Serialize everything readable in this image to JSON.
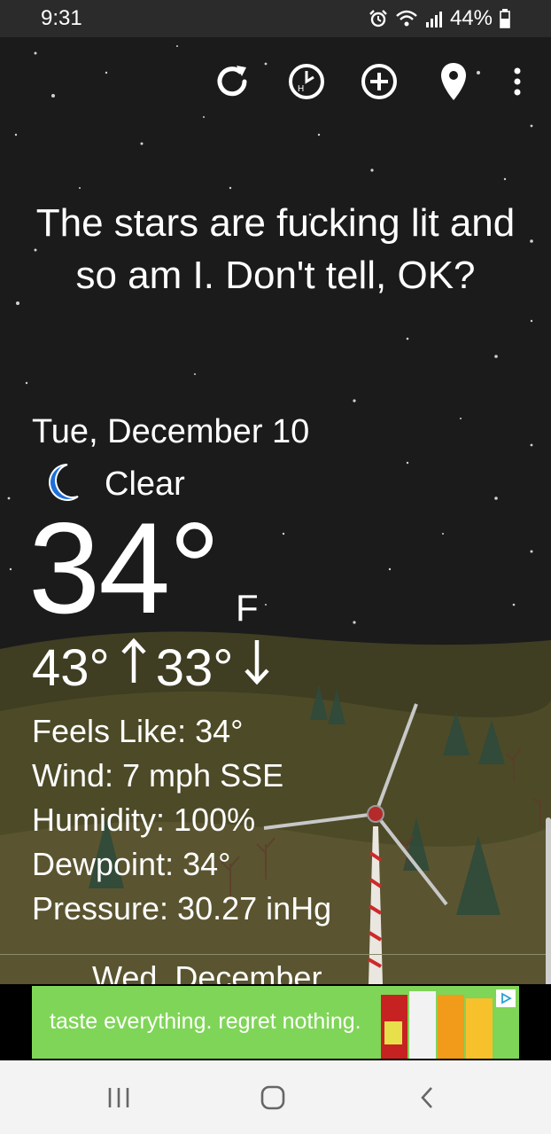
{
  "status_bar": {
    "time": "9:31",
    "battery": "44%",
    "icons": [
      "alarm-icon",
      "wifi-icon",
      "signal-icon",
      "battery-icon"
    ]
  },
  "toolbar": {
    "icons": [
      "refresh-icon",
      "history-icon",
      "add-icon",
      "location-icon",
      "overflow-menu-icon"
    ]
  },
  "quote": "The stars are fucking lit and so am I. Don't tell, OK?",
  "current": {
    "date": "Tue, December 10",
    "condition": "Clear",
    "condition_icon": "moon-icon",
    "temperature": "34°",
    "unit": "F",
    "high": "43°",
    "low": "33°"
  },
  "details": {
    "feels_like": "Feels Like: 34°",
    "wind": "Wind: 7 mph SSE",
    "humidity": "Humidity: 100%",
    "dewpoint": "Dewpoint: 34°",
    "pressure": "Pressure: 30.27 inHg"
  },
  "next_day": {
    "date": "Wed, December"
  },
  "ad": {
    "text": "taste everything. regret nothing.",
    "brand_color": "#7fd557"
  },
  "nav": {
    "icons": [
      "recent-apps-icon",
      "home-icon",
      "back-icon"
    ]
  },
  "colors": {
    "background": "#1b1b1c",
    "moon": "#1e6fd9",
    "hill": "#4d4a27"
  }
}
